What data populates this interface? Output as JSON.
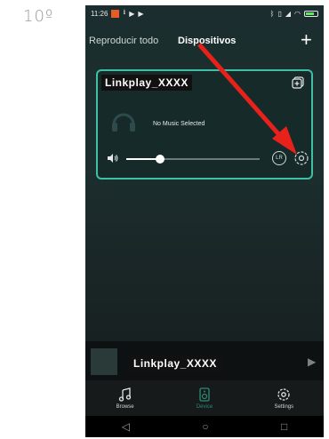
{
  "step_label": "10º",
  "status_bar": {
    "time": "11:26",
    "left_icons": [
      "flag-icon",
      "download-icon",
      "play-icon",
      "play-icon"
    ],
    "right_icons": [
      "bluetooth-icon",
      "vibrate-icon",
      "signal-icon",
      "wifi-icon",
      "battery-icon"
    ]
  },
  "tabs": {
    "all_label": "Reproducir todo",
    "devices_label": "Dispositivos",
    "add_label": "+"
  },
  "device_card": {
    "name": "Linkplay_XXXX",
    "status": "No Music Selected",
    "volume_fraction": 0.25,
    "lr_label": "LR"
  },
  "now_playing": {
    "title": "Linkplay_XXXX"
  },
  "bottom_nav": {
    "items": [
      {
        "label": "Browse",
        "icon": "music-note-icon",
        "active": false
      },
      {
        "label": "Device",
        "icon": "device-icon",
        "active": true
      },
      {
        "label": "Settings",
        "icon": "gear-icon",
        "active": false
      }
    ]
  },
  "colors": {
    "accent": "#3fbfa6",
    "arrow": "#e8211a",
    "nav_active": "#2c8c70"
  }
}
